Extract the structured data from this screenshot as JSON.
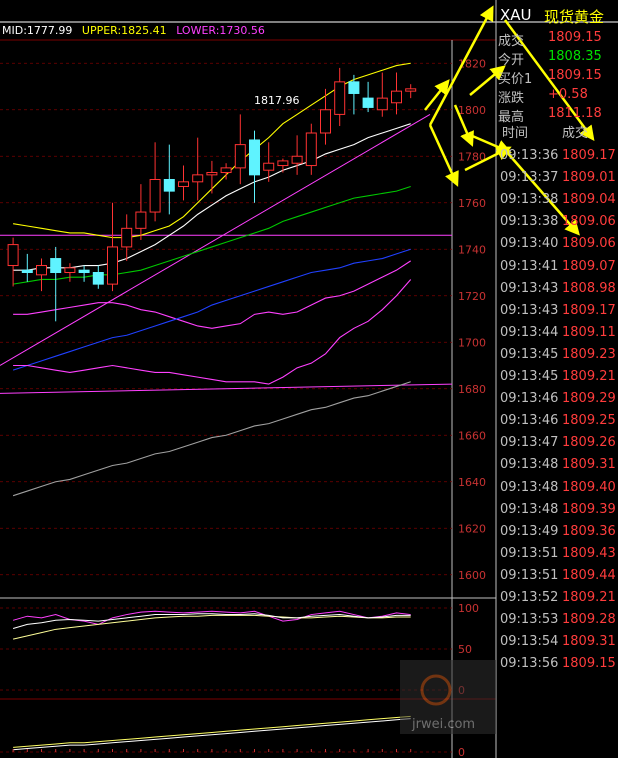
{
  "header": {
    "mid": "MID:1777.99",
    "upper": "UPPER:1825.41",
    "lower": "LOWER:1730.56",
    "price_tag": "1817.96"
  },
  "colors": {
    "mid": "#ffffff",
    "upper": "#ffff00",
    "lower": "#ff40ff",
    "up_candle": "#ff3333",
    "down_candle": "#5ff3ff",
    "grid": "#7a0000",
    "axis_text": "#c83232",
    "arrow": "#ffff00"
  },
  "panel": {
    "symbol": "XAU",
    "name": "现货黄金",
    "quotes": [
      {
        "label": "成交",
        "value": "1809.15",
        "color": "#ff3c3c"
      },
      {
        "label": "今开",
        "value": "1808.35",
        "color": "#00e000"
      },
      {
        "label": "买价1",
        "value": "1809.15",
        "color": "#ff3c3c"
      },
      {
        "label": "涨跌",
        "value": "+0.58",
        "color": "#ff3c3c"
      },
      {
        "label": "最高",
        "value": "1811.18",
        "color": "#ff3c3c"
      }
    ],
    "col_time": "时间",
    "col_price": "成交",
    "ticks": [
      {
        "time": "09:13:36",
        "price": "1809.17"
      },
      {
        "time": "09:13:37",
        "price": "1809.01"
      },
      {
        "time": "09:13:38",
        "price": "1809.04"
      },
      {
        "time": "09:13:38",
        "price": "1809.06"
      },
      {
        "time": "09:13:40",
        "price": "1809.06"
      },
      {
        "time": "09:13:41",
        "price": "1809.07"
      },
      {
        "time": "09:13:43",
        "price": "1808.98"
      },
      {
        "time": "09:13:43",
        "price": "1809.17"
      },
      {
        "time": "09:13:44",
        "price": "1809.11"
      },
      {
        "time": "09:13:45",
        "price": "1809.23"
      },
      {
        "time": "09:13:45",
        "price": "1809.21"
      },
      {
        "time": "09:13:46",
        "price": "1809.29"
      },
      {
        "time": "09:13:46",
        "price": "1809.25"
      },
      {
        "time": "09:13:47",
        "price": "1809.26"
      },
      {
        "time": "09:13:48",
        "price": "1809.31"
      },
      {
        "time": "09:13:48",
        "price": "1809.40"
      },
      {
        "time": "09:13:48",
        "price": "1809.39"
      },
      {
        "time": "09:13:49",
        "price": "1809.36"
      },
      {
        "time": "09:13:51",
        "price": "1809.43"
      },
      {
        "time": "09:13:51",
        "price": "1809.44"
      },
      {
        "time": "09:13:52",
        "price": "1809.21"
      },
      {
        "time": "09:13:53",
        "price": "1809.28"
      },
      {
        "time": "09:13:54",
        "price": "1809.31"
      },
      {
        "time": "09:13:56",
        "price": "1809.15"
      }
    ]
  },
  "watermark": "jrwei.com",
  "chart_data": {
    "type": "candlestick",
    "y_ticks": [
      1820,
      1800,
      1780,
      1760,
      1740,
      1720,
      1700,
      1680,
      1660,
      1640,
      1620,
      1600
    ],
    "ylim": [
      1590,
      1830
    ],
    "grid": true,
    "candles": [
      {
        "o": 1733,
        "h": 1745,
        "l": 1724,
        "c": 1742
      },
      {
        "o": 1731,
        "h": 1738,
        "l": 1726,
        "c": 1730
      },
      {
        "o": 1729,
        "h": 1736,
        "l": 1722,
        "c": 1733
      },
      {
        "o": 1736,
        "h": 1741,
        "l": 1709,
        "c": 1730
      },
      {
        "o": 1730,
        "h": 1734,
        "l": 1726,
        "c": 1732
      },
      {
        "o": 1731,
        "h": 1733,
        "l": 1726,
        "c": 1730
      },
      {
        "o": 1730,
        "h": 1733,
        "l": 1723,
        "c": 1725
      },
      {
        "o": 1725,
        "h": 1760,
        "l": 1722,
        "c": 1741
      },
      {
        "o": 1741,
        "h": 1755,
        "l": 1735,
        "c": 1749
      },
      {
        "o": 1749,
        "h": 1768,
        "l": 1744,
        "c": 1756
      },
      {
        "o": 1756,
        "h": 1786,
        "l": 1752,
        "c": 1770
      },
      {
        "o": 1770,
        "h": 1785,
        "l": 1755,
        "c": 1765
      },
      {
        "o": 1767,
        "h": 1776,
        "l": 1761,
        "c": 1769
      },
      {
        "o": 1769,
        "h": 1788,
        "l": 1761,
        "c": 1772
      },
      {
        "o": 1772,
        "h": 1778,
        "l": 1764,
        "c": 1773
      },
      {
        "o": 1773,
        "h": 1777,
        "l": 1770,
        "c": 1775
      },
      {
        "o": 1775,
        "h": 1798,
        "l": 1768,
        "c": 1785
      },
      {
        "o": 1787,
        "h": 1791,
        "l": 1760,
        "c": 1772
      },
      {
        "o": 1774,
        "h": 1786,
        "l": 1769,
        "c": 1777
      },
      {
        "o": 1776,
        "h": 1779,
        "l": 1773,
        "c": 1778
      },
      {
        "o": 1777,
        "h": 1789,
        "l": 1772,
        "c": 1780
      },
      {
        "o": 1776,
        "h": 1794,
        "l": 1772,
        "c": 1790
      },
      {
        "o": 1790,
        "h": 1809,
        "l": 1785,
        "c": 1800
      },
      {
        "o": 1798,
        "h": 1818,
        "l": 1793,
        "c": 1812
      },
      {
        "o": 1812,
        "h": 1815,
        "l": 1798,
        "c": 1807
      },
      {
        "o": 1805,
        "h": 1812,
        "l": 1799,
        "c": 1801
      },
      {
        "o": 1800,
        "h": 1816,
        "l": 1797,
        "c": 1805
      },
      {
        "o": 1803,
        "h": 1816,
        "l": 1798,
        "c": 1808
      },
      {
        "o": 1808,
        "h": 1811,
        "l": 1805,
        "c": 1809
      }
    ],
    "series": [
      {
        "role": "upper",
        "values": [
          1751,
          1750,
          1749,
          1748,
          1747,
          1747,
          1746,
          1745,
          1745,
          1746,
          1748,
          1750,
          1754,
          1760,
          1766,
          1772,
          1778,
          1783,
          1788,
          1794,
          1798,
          1802,
          1806,
          1810,
          1813,
          1815,
          1817,
          1819,
          1820
        ]
      },
      {
        "role": "mid",
        "values": [
          1731,
          1731,
          1732,
          1732,
          1732,
          1733,
          1733,
          1734,
          1736,
          1739,
          1742,
          1746,
          1750,
          1755,
          1759,
          1763,
          1766,
          1769,
          1771,
          1774,
          1776,
          1778,
          1781,
          1783,
          1785,
          1788,
          1790,
          1792,
          1794
        ]
      },
      {
        "role": "lower",
        "values": [
          1712,
          1712,
          1713,
          1714,
          1715,
          1716,
          1717,
          1717,
          1716,
          1714,
          1713,
          1711,
          1709,
          1707,
          1706,
          1707,
          1708,
          1712,
          1713,
          1712,
          1713,
          1716,
          1719,
          1720,
          1722,
          1725,
          1728,
          1731,
          1735
        ]
      },
      {
        "role": "ma_green",
        "values": [
          1725,
          1726,
          1727,
          1727,
          1728,
          1728,
          1729,
          1729,
          1730,
          1731,
          1733,
          1735,
          1737,
          1739,
          1741,
          1743,
          1745,
          1747,
          1749,
          1752,
          1754,
          1756,
          1758,
          1760,
          1762,
          1763,
          1764,
          1765,
          1767
        ]
      },
      {
        "role": "ma_blue",
        "values": [
          1688,
          1690,
          1692,
          1694,
          1696,
          1698,
          1700,
          1702,
          1703,
          1705,
          1707,
          1709,
          1711,
          1713,
          1716,
          1718,
          1720,
          1722,
          1724,
          1726,
          1728,
          1730,
          1731,
          1732,
          1734,
          1735,
          1736,
          1738,
          1740
        ]
      },
      {
        "role": "ma_magenta",
        "values": [
          1690,
          1690,
          1689,
          1688,
          1687,
          1688,
          1689,
          1690,
          1689,
          1688,
          1687,
          1687,
          1686,
          1685,
          1684,
          1683,
          1683,
          1683,
          1682,
          1685,
          1689,
          1691,
          1695,
          1702,
          1706,
          1709,
          1714,
          1720,
          1727
        ]
      },
      {
        "role": "ma_gray",
        "values": [
          1634,
          1636,
          1638,
          1640,
          1641,
          1643,
          1645,
          1647,
          1648,
          1650,
          1652,
          1653,
          1655,
          1657,
          1659,
          1660,
          1662,
          1664,
          1665,
          1667,
          1669,
          1671,
          1672,
          1674,
          1676,
          1677,
          1679,
          1681,
          1683
        ]
      }
    ],
    "indicators": [
      {
        "ticks": [
          100,
          50,
          0
        ],
        "lines": [
          {
            "color": "#ff40ff",
            "values": [
              85,
              90,
              88,
              92,
              86,
              84,
              80,
              88,
              92,
              95,
              96,
              95,
              94,
              95,
              96,
              95,
              94,
              96,
              90,
              84,
              86,
              92,
              94,
              96,
              92,
              88,
              90,
              94,
              92
            ]
          },
          {
            "color": "#ffff99",
            "values": [
              62,
              66,
              70,
              74,
              76,
              78,
              80,
              82,
              84,
              86,
              88,
              89,
              90,
              90,
              91,
              91,
              91,
              91,
              90,
              89,
              88,
              88,
              89,
              90,
              89,
              88,
              88,
              89,
              89
            ]
          },
          {
            "color": "#ffffff",
            "values": [
              75,
              80,
              82,
              85,
              86,
              85,
              84,
              86,
              88,
              90,
              92,
              92,
              92,
              93,
              93,
              92,
              92,
              93,
              91,
              88,
              88,
              90,
              91,
              92,
              90,
              88,
              89,
              91,
              91
            ]
          }
        ]
      },
      {
        "ticks": [
          0
        ],
        "lines": [
          {
            "color": "#ffff66",
            "values": [
              4,
              5,
              6,
              7,
              8,
              8,
              9,
              10,
              11,
              12,
              13,
              14,
              15,
              16,
              17,
              18,
              19,
              20,
              21,
              22,
              23,
              24,
              25,
              26,
              27,
              28,
              29,
              30,
              31
            ]
          },
          {
            "color": "#ffffff",
            "values": [
              2,
              3,
              4,
              5,
              6,
              6,
              7,
              8,
              9,
              10,
              11,
              12,
              13,
              14,
              15,
              16,
              17,
              18,
              19,
              20,
              21,
              22,
              23,
              24,
              25,
              26,
              27,
              28,
              29
            ]
          }
        ]
      }
    ]
  }
}
